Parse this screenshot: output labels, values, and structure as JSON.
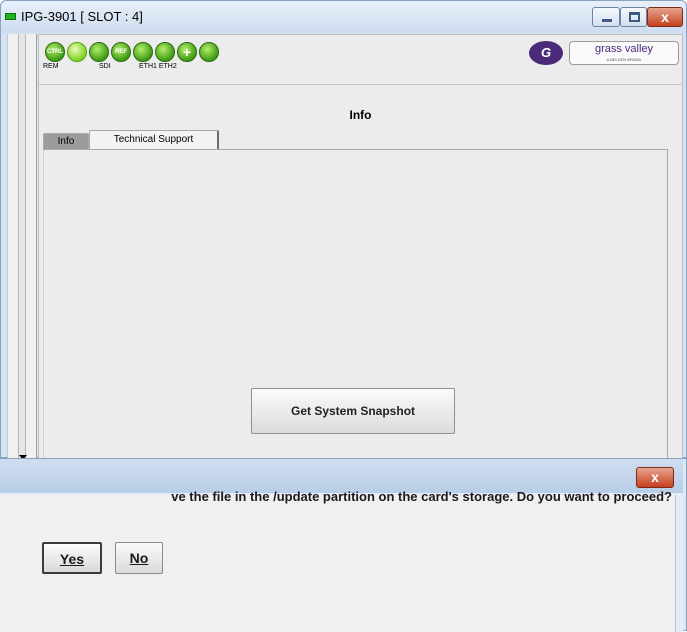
{
  "window": {
    "title": "IPG-3901 [ SLOT : 4]",
    "close_glyph": "x"
  },
  "icon_bar": {
    "icons": [
      {
        "name": "ctrl-icon",
        "text": "CTRL"
      },
      {
        "name": "status-sparkle-icon",
        "text": ""
      },
      {
        "name": "sdi-icon",
        "text": ""
      },
      {
        "name": "ref-icon",
        "text": "REF"
      },
      {
        "name": "eth1-icon",
        "text": ""
      },
      {
        "name": "eth2-icon",
        "text": ""
      },
      {
        "name": "plus-icon",
        "text": "+"
      },
      {
        "name": "alarm-icon",
        "text": ""
      }
    ],
    "labels": {
      "rem": "REM",
      "sdi": "SDI",
      "eth": "ETH1 ETH2"
    },
    "logo": {
      "mark": "G",
      "text": "grass valley",
      "sub": "A BELDEN BRAND"
    }
  },
  "main": {
    "section_title": "Info",
    "tabs": [
      {
        "label": "Info"
      },
      {
        "label": "Technical Support"
      }
    ],
    "snapshot_button": "Get System Snapshot"
  },
  "dialog": {
    "close_glyph": "x",
    "message": "ve the file in the /update partition on the card's storage. Do you want to proceed?",
    "yes_label": "Yes",
    "no_label": "No"
  },
  "colors": {
    "title_led": "#1eb41e",
    "close_red": "#c4401f",
    "logo_purple": "#4b2a7a",
    "status_green": "#3f9a14"
  }
}
